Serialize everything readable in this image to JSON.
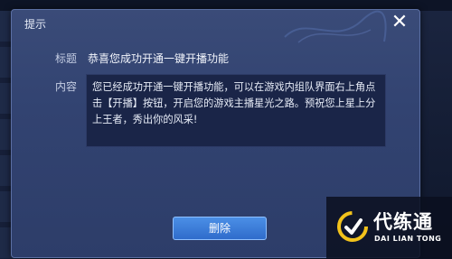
{
  "dialog": {
    "title": "提示",
    "close_icon": "close-icon",
    "fields": {
      "title_label": "标题",
      "title_value": "恭喜您成功开通一键开播功能",
      "content_label": "内容",
      "content_value": "您已经成功开通一键开播功能，可以在游戏内组队界面右上角点击【开播】按钮，开启您的游戏主播星光之路。预祝您上星上分上王者，秀出你的风采!"
    },
    "delete_button": "删除"
  },
  "watermark": {
    "text": "代练通",
    "subtext": "DAI LIAN TONG"
  },
  "colors": {
    "dialog_bg": "#324371",
    "content_bg": "#1a2548",
    "button": "#3a7ad8",
    "watermark_logo": "#f2c21b"
  }
}
